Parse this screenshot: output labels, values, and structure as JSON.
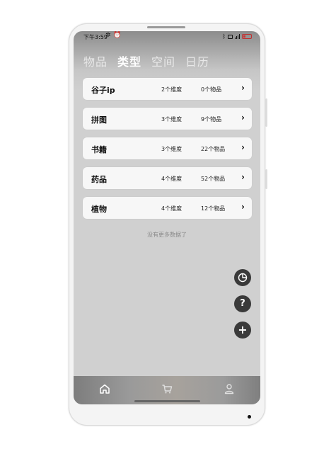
{
  "status_bar": {
    "time": "下午3:59",
    "settings_icon": "gear-icon",
    "alarm_icon": "alarm-icon",
    "bluetooth_icon": "bluetooth-icon",
    "battery_color": "#d03030"
  },
  "tabs": [
    {
      "label": "物品",
      "active": false
    },
    {
      "label": "类型",
      "active": true
    },
    {
      "label": "空间",
      "active": false
    },
    {
      "label": "日历",
      "active": false
    }
  ],
  "types": [
    {
      "name": "谷子ip",
      "dimensions": "2个维度",
      "items": "0个物品"
    },
    {
      "name": "拼图",
      "dimensions": "3个维度",
      "items": "9个物品"
    },
    {
      "name": "书籍",
      "dimensions": "3个维度",
      "items": "22个物品"
    },
    {
      "name": "药品",
      "dimensions": "4个维度",
      "items": "52个物品"
    },
    {
      "name": "植物",
      "dimensions": "4个维度",
      "items": "12个物品"
    }
  ],
  "chevron": "›",
  "no_more_text": "没有更多数据了",
  "fabs": {
    "chart_icon": "pie-chart-icon",
    "help_label": "?",
    "add_label": "+"
  },
  "bottom_nav": [
    "home-icon",
    "cart-icon",
    "profile-icon"
  ]
}
